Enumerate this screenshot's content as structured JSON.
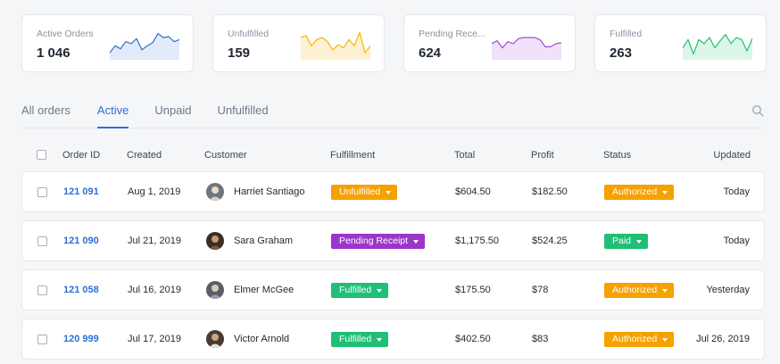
{
  "stats": [
    {
      "label": "Active Orders",
      "value": "1 046",
      "color": "#2d6fd6",
      "fill": "#e3ebfb",
      "points": [
        5,
        12,
        9,
        16,
        14,
        19,
        8,
        12,
        15,
        24,
        20,
        21,
        16,
        18
      ]
    },
    {
      "label": "Unfulfilled",
      "value": "159",
      "color": "#f5b700",
      "fill": "#fdf1d3",
      "points": [
        20,
        22,
        12,
        18,
        20,
        16,
        8,
        13,
        10,
        18,
        12,
        25,
        5,
        12
      ]
    },
    {
      "label": "Pending Rece...",
      "value": "624",
      "color": "#9b4dd6",
      "fill": "#efe2fa",
      "points": [
        14,
        17,
        10,
        16,
        14,
        19,
        20,
        20,
        20,
        18,
        11,
        11,
        14,
        15
      ]
    },
    {
      "label": "Fulfilled",
      "value": "263",
      "color": "#1fbf75",
      "fill": "#dcf6e9",
      "points": [
        10,
        18,
        4,
        18,
        14,
        20,
        10,
        17,
        23,
        14,
        20,
        18,
        7,
        19
      ]
    }
  ],
  "tabs": [
    "All orders",
    "Active",
    "Unpaid",
    "Unfulfilled"
  ],
  "active_tab": "Active",
  "columns": {
    "order_id": "Order ID",
    "created": "Created",
    "customer": "Customer",
    "fulfillment": "Fulfillment",
    "total": "Total",
    "profit": "Profit",
    "status": "Status",
    "updated": "Updated"
  },
  "rows": [
    {
      "order_id": "121 091",
      "created": "Aug 1, 2019",
      "customer": "Harriet Santiago",
      "fulfillment": "Unfulfilled",
      "fulfillment_color": "#f5a100",
      "total": "$604.50",
      "profit": "$182.50",
      "status": "Authorized",
      "status_color": "#f5a100",
      "updated": "Today",
      "avatar_color": "#6d757d"
    },
    {
      "order_id": "121 090",
      "created": "Jul 21, 2019",
      "customer": "Sara Graham",
      "fulfillment": "Pending Receipt",
      "fulfillment_color": "#9b36c9",
      "total": "$1,175.50",
      "profit": "$524.25",
      "status": "Paid",
      "status_color": "#1fbf75",
      "updated": "Today",
      "avatar_color": "#3b2e22"
    },
    {
      "order_id": "121 058",
      "created": "Jul 16, 2019",
      "customer": "Elmer McGee",
      "fulfillment": "Fulfilled",
      "fulfillment_color": "#1fbf75",
      "total": "$175.50",
      "profit": "$78",
      "status": "Authorized",
      "status_color": "#f5a100",
      "updated": "Yesterday",
      "avatar_color": "#5a5f66"
    },
    {
      "order_id": "120 999",
      "created": "Jul 17, 2019",
      "customer": "Victor Arnold",
      "fulfillment": "Fulfilled",
      "fulfillment_color": "#1fbf75",
      "total": "$402.50",
      "profit": "$83",
      "status": "Authorized",
      "status_color": "#f5a100",
      "updated": "Jul 26, 2019",
      "avatar_color": "#4a3a30"
    }
  ]
}
